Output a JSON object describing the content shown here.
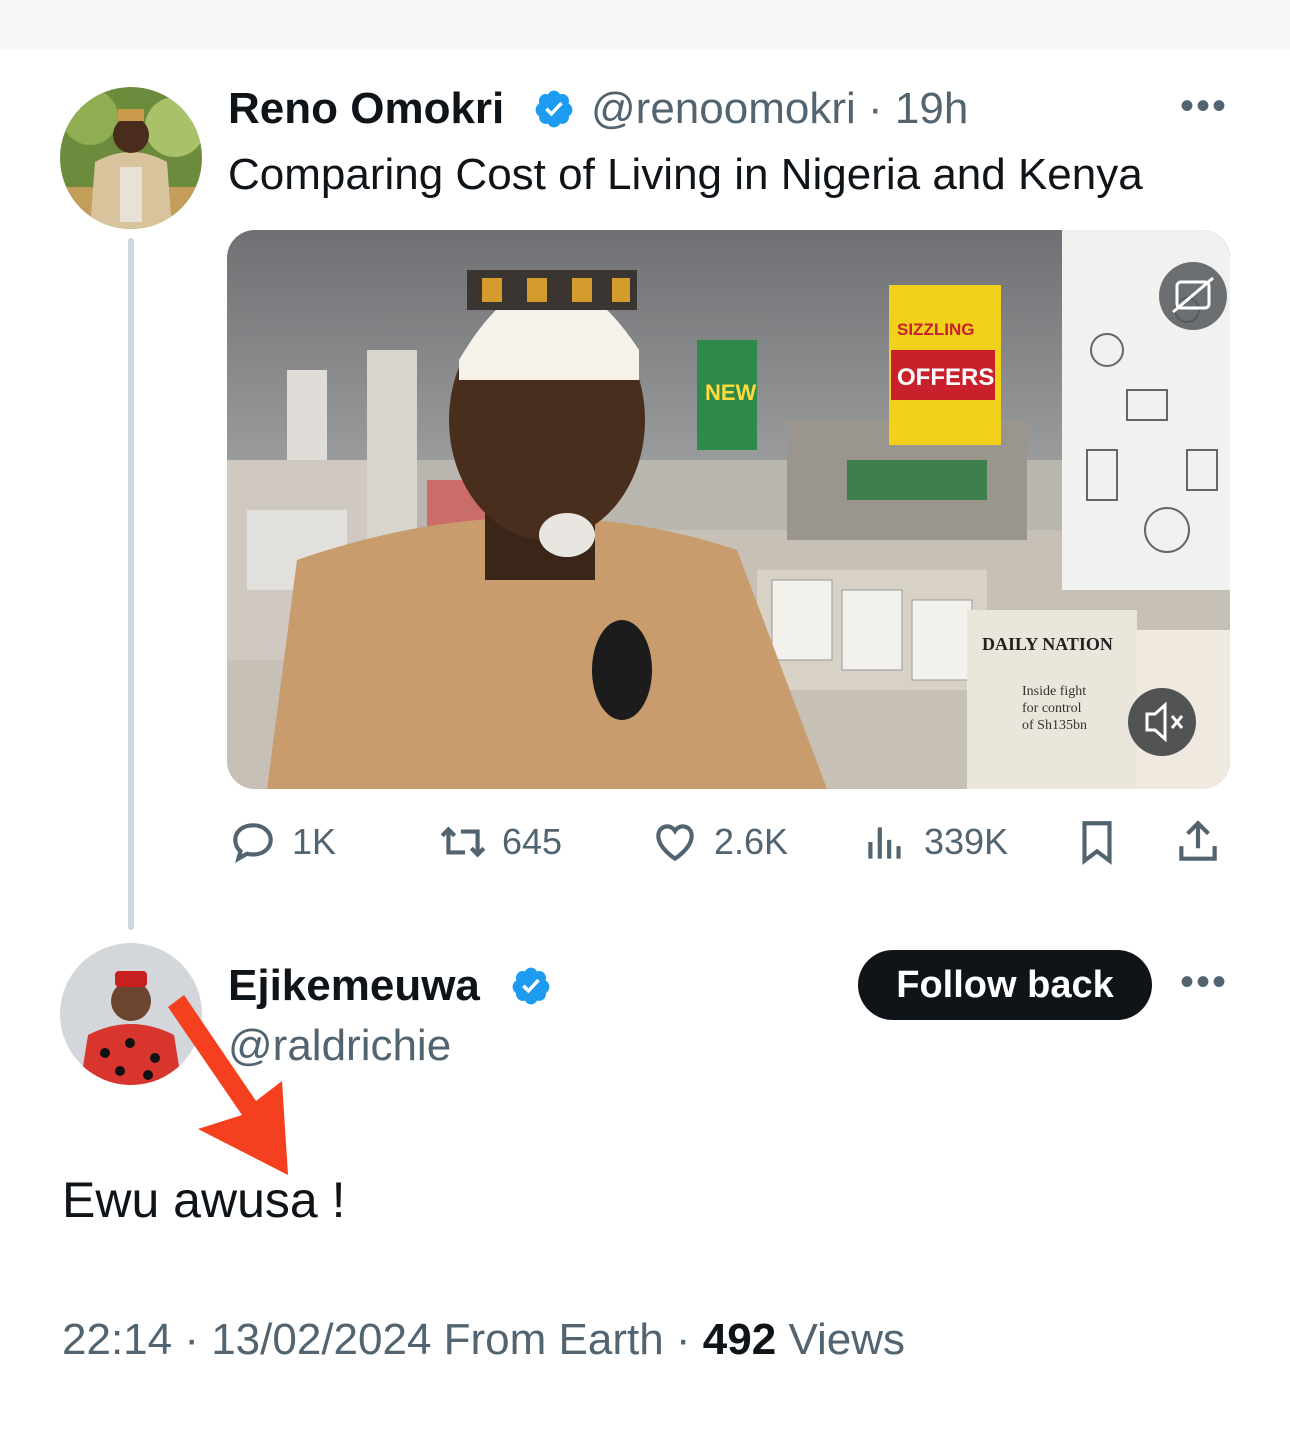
{
  "tweet": {
    "author_name": "Reno Omokri",
    "author_handle": "@renoomokri",
    "time_sep": "·",
    "time": "19h",
    "text": "Comparing Cost of Living in Nigeria and Kenya",
    "media": {
      "sign_sizzling": "SIZZLING",
      "sign_offers": "OFFERS",
      "sign_new": "NEW",
      "newspaper_masthead": "DAILY NATION",
      "newspaper_headline_1": "Inside fight",
      "newspaper_headline_2": "for control",
      "newspaper_headline_3": "of Sh135bn",
      "caption_icon": "closed-caption-icon",
      "mute_icon": "mute-icon"
    },
    "actions": {
      "replies": "1K",
      "retweets": "645",
      "likes": "2.6K",
      "views": "339K"
    }
  },
  "reply": {
    "author_name": "Ejikemeuwa",
    "author_handle": "@raldrichie",
    "follow_button": "Follow back",
    "text": "Ewu awusa !",
    "timestamp": "22:14 · 13/02/2024 From Earth · ",
    "views_count": "492",
    "views_label": " Views"
  },
  "colors": {
    "verified": "#1d9bf0",
    "annotation_arrow": "#f4401f",
    "secondary_text": "#536471",
    "button_bg": "#0f1419"
  }
}
